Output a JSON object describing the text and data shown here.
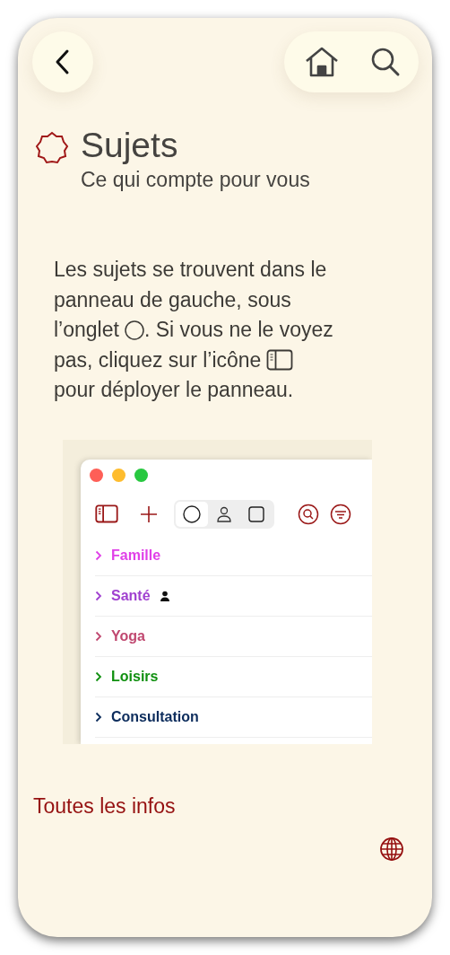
{
  "header": {
    "title": "Sujets",
    "subtitle": "Ce qui compte pour vous"
  },
  "body": [
    {
      "text": "Les sujets se trouvent dans le"
    },
    {
      "text": "panneau de gauche, sous"
    },
    {
      "text": "l’onglet",
      "kind": "circle",
      "rest": ". Si vous ne le voyez"
    },
    {
      "text": "pas, cliquez sur l’icône",
      "kind": "sidebar"
    },
    {
      "text": "pour déployer le panneau."
    }
  ],
  "preview": {
    "segments": [
      {
        "kind": "circle",
        "selected": true
      },
      {
        "kind": "person",
        "selected": false
      },
      {
        "kind": "square",
        "selected": false
      }
    ],
    "topics": [
      {
        "name": "Famille",
        "color": "#e040e8",
        "shared": false
      },
      {
        "name": "Santé",
        "color": "#a040d0",
        "shared": true
      },
      {
        "name": "Yoga",
        "color": "#c04870",
        "shared": false
      },
      {
        "name": "Loisirs",
        "color": "#109010",
        "shared": false
      },
      {
        "name": "Consultation",
        "color": "#0c2c5c",
        "shared": false
      }
    ]
  },
  "link": "Toutes les infos"
}
